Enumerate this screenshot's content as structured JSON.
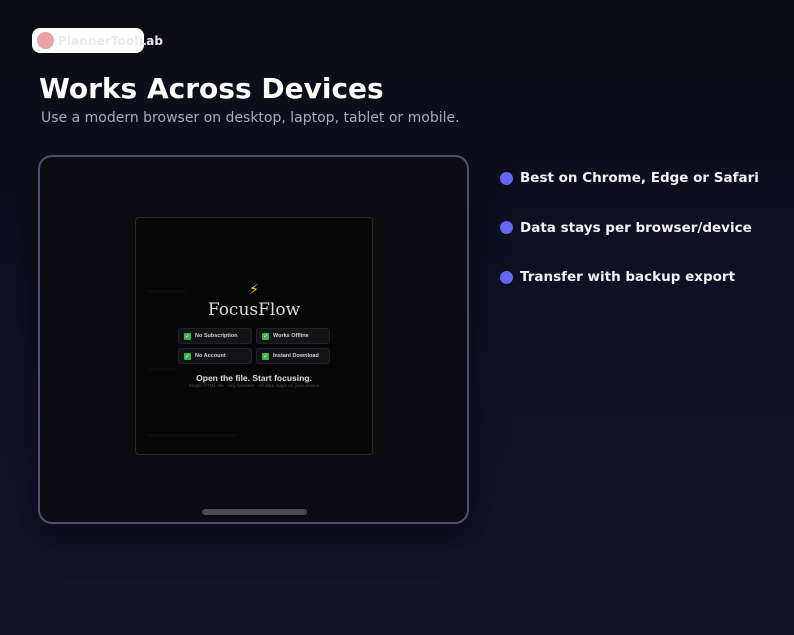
{
  "brand": {
    "name": "PlannerToolLab"
  },
  "hero": {
    "title": "Works Across Devices",
    "subtitle": "Use a modern browser on desktop, laptop, tablet or mobile."
  },
  "tablet_preview": {
    "bolt_glyph": "⚡",
    "app_title": "FocusFlow",
    "features": [
      "No Subscription",
      "Works Offline",
      "No Account",
      "Instant Download"
    ],
    "check_glyph": "✓",
    "cta": "Open the file. Start focusing.",
    "cta_sub": "Single HTML file · Any browser · All data stays on your device"
  },
  "benefits": [
    "Best on Chrome, Edge or Safari",
    "Data stays per browser/device",
    "Transfer with backup export"
  ],
  "colors": {
    "accent": "#6366f1",
    "background": "#0f1022",
    "check": "#39b34a"
  }
}
